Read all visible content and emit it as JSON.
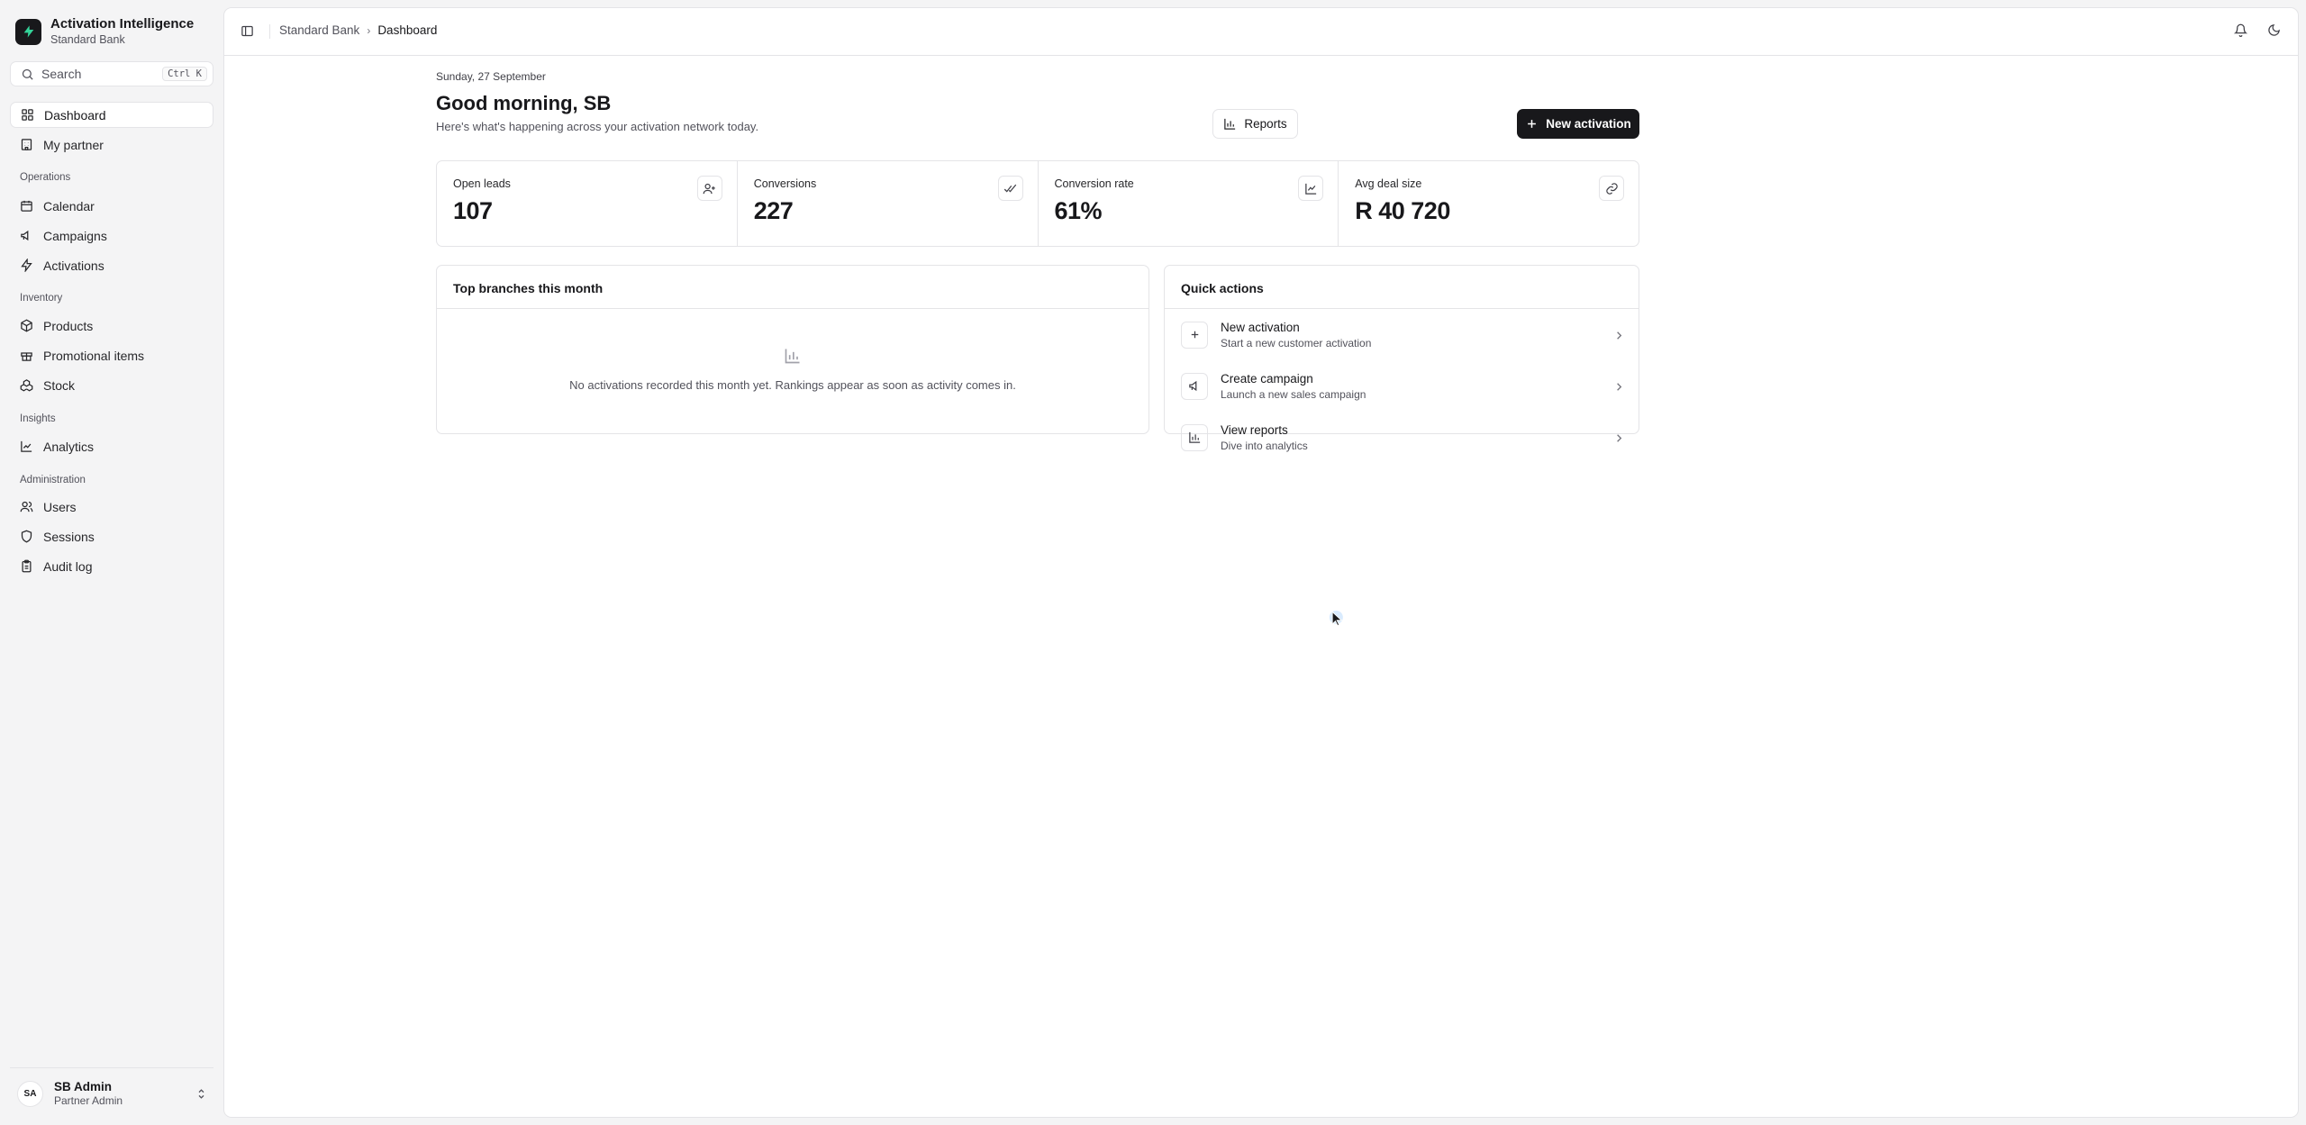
{
  "sidebar": {
    "brand": {
      "title": "Activation Intelligence",
      "subtitle": "Standard Bank"
    },
    "search": {
      "label": "Search",
      "shortcut": "Ctrl K"
    },
    "top_items": [
      {
        "label": "Dashboard",
        "icon": "dashboard-icon",
        "active": true
      },
      {
        "label": "My partner",
        "icon": "building-icon",
        "active": false
      }
    ],
    "groups": [
      {
        "label": "Operations",
        "items": [
          {
            "label": "Calendar",
            "icon": "calendar-icon"
          },
          {
            "label": "Campaigns",
            "icon": "megaphone-icon"
          },
          {
            "label": "Activations",
            "icon": "zap-icon"
          }
        ]
      },
      {
        "label": "Inventory",
        "items": [
          {
            "label": "Products",
            "icon": "package-icon"
          },
          {
            "label": "Promotional items",
            "icon": "gift-icon"
          },
          {
            "label": "Stock",
            "icon": "boxes-icon"
          }
        ]
      },
      {
        "label": "Insights",
        "items": [
          {
            "label": "Analytics",
            "icon": "line-chart-icon"
          }
        ]
      },
      {
        "label": "Administration",
        "items": [
          {
            "label": "Users",
            "icon": "users-icon"
          },
          {
            "label": "Sessions",
            "icon": "shield-icon"
          },
          {
            "label": "Audit log",
            "icon": "clipboard-icon"
          }
        ]
      }
    ],
    "user": {
      "initials": "SA",
      "name": "SB Admin",
      "role": "Partner Admin"
    }
  },
  "topbar": {
    "breadcrumb": {
      "root": "Standard Bank",
      "current": "Dashboard"
    }
  },
  "page": {
    "date": "Sunday, 27 September",
    "greeting": "Good morning, SB",
    "subtitle": "Here's what's happening across your activation network today.",
    "reports_label": "Reports",
    "new_activation_label": "New activation"
  },
  "stats": [
    {
      "label": "Open leads",
      "value": "107",
      "icon": "user-plus-icon"
    },
    {
      "label": "Conversions",
      "value": "227",
      "icon": "check-check-icon"
    },
    {
      "label": "Conversion rate",
      "value": "61%",
      "icon": "chart-line-icon"
    },
    {
      "label": "Avg deal size",
      "value": "R 40 720",
      "icon": "link-icon"
    }
  ],
  "top_branches": {
    "title": "Top branches this month",
    "empty_text": "No activations recorded this month yet. Rankings appear as soon as activity comes in."
  },
  "quick_actions": {
    "title": "Quick actions",
    "items": [
      {
        "title": "New activation",
        "subtitle": "Start a new customer activation",
        "icon": "plus-icon"
      },
      {
        "title": "Create campaign",
        "subtitle": "Launch a new sales campaign",
        "icon": "megaphone-icon"
      },
      {
        "title": "View reports",
        "subtitle": "Dive into analytics",
        "icon": "bar-chart-icon"
      }
    ]
  },
  "colors": {
    "accent": "#18181b",
    "brand_bolt": "#34d399",
    "border": "#e4e4e7",
    "sidebar_bg": "#f4f4f5"
  }
}
